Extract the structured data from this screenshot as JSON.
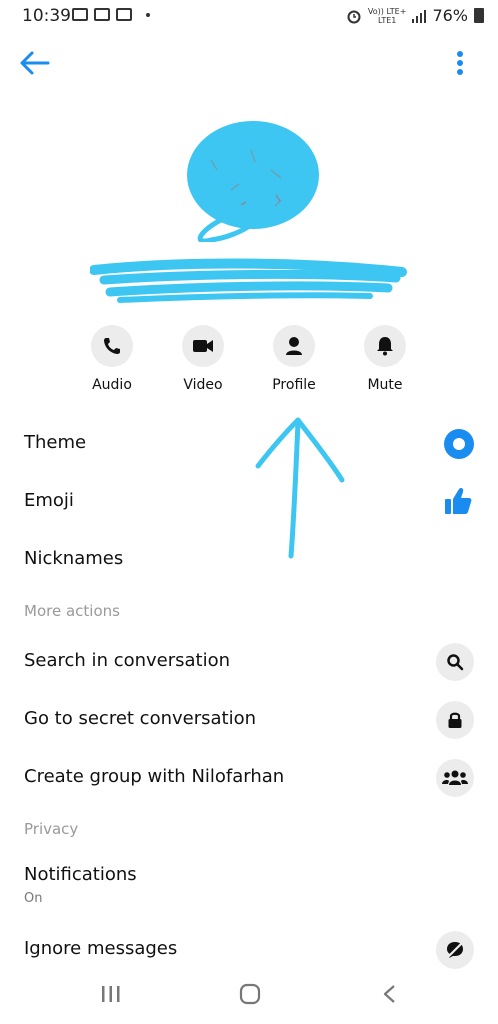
{
  "status_bar": {
    "time": "10:39",
    "network_top": "Vo)) LTE+",
    "network_bottom": "LTE1",
    "battery": "76%"
  },
  "colors": {
    "accent": "#1a8cf0",
    "scribble": "#3ec6f2",
    "circle_bg": "#ececec"
  },
  "actions": [
    {
      "label": "Audio",
      "icon": "phone-icon"
    },
    {
      "label": "Video",
      "icon": "video-camera-icon"
    },
    {
      "label": "Profile",
      "icon": "person-icon"
    },
    {
      "label": "Mute",
      "icon": "bell-icon"
    }
  ],
  "settings": {
    "theme": "Theme",
    "emoji": "Emoji",
    "nicknames": "Nicknames"
  },
  "more_actions": {
    "header": "More actions",
    "search": "Search in conversation",
    "secret": "Go to secret conversation",
    "create_group": "Create group with Nilofarhan"
  },
  "privacy": {
    "header": "Privacy",
    "notifications": "Notifications",
    "notifications_value": "On",
    "ignore": "Ignore messages"
  }
}
